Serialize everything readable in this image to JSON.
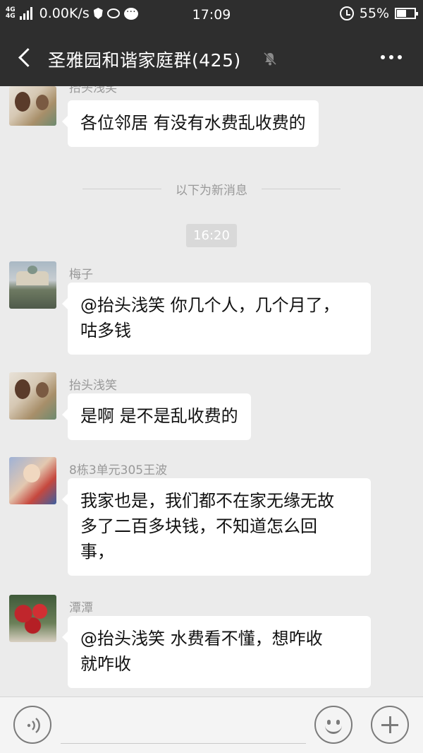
{
  "status_bar": {
    "network_top": "4G",
    "network_bottom": "4G",
    "speed": "0.00K/s",
    "time": "17:09",
    "battery": "55%",
    "battery_level": 0.55,
    "icons": [
      "signal-icon",
      "shield-icon",
      "weibo-icon",
      "message-icon",
      "alarm-icon",
      "battery-icon"
    ]
  },
  "header": {
    "title": "圣雅园和谐家庭群(425)",
    "back_icon": "back-arrow-icon",
    "mute_icon": "mute-bell-icon",
    "more_icon": "more-icon"
  },
  "messages": [
    {
      "sender": "抬头浅笑",
      "text": "各位邻居 有没有水费乱收费的"
    },
    {
      "sender": "梅子",
      "lines": [
        "@抬头浅笑  你几个人，几个月了，",
        "咕多钱"
      ]
    },
    {
      "sender": "抬头浅笑",
      "text": "是啊 是不是乱收费的"
    },
    {
      "sender": "8栋3单元305王波",
      "lines": [
        "我家也是，我们都不在家无缘无故",
        "多了二百多块钱，不知道怎么回",
        "事，"
      ]
    },
    {
      "sender": "潭潭",
      "lines": [
        "@抬头浅笑  水费看不懂，想咋收",
        "就咋收"
      ]
    }
  ],
  "divider_text": "以下为新消息",
  "time_label": "16:20",
  "input_bar": {
    "placeholder": "",
    "icons": [
      "voice-icon",
      "emoji-icon",
      "plus-icon"
    ]
  },
  "colors": {
    "bar_bg": "#2e2e2e",
    "chat_bg": "#ebebeb",
    "bubble_bg": "#ffffff",
    "meta_text": "#999999"
  }
}
